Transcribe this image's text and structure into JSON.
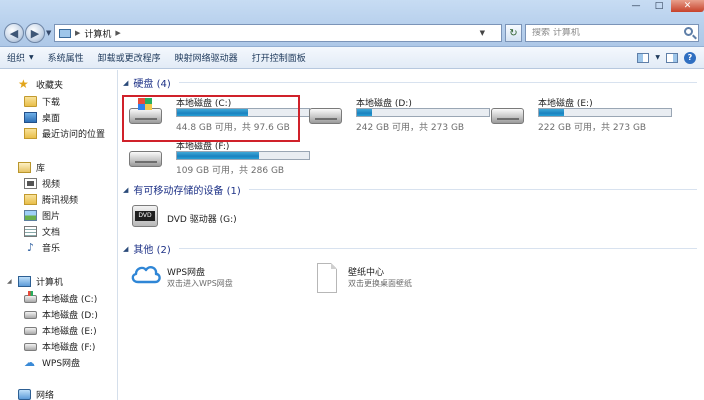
{
  "window": {
    "address_crumb": "计算机",
    "search_placeholder": "搜索 计算机",
    "controls": {
      "minimize": "—",
      "maximize": "□",
      "close": "✕"
    }
  },
  "toolbar": {
    "organize": "组织",
    "system_properties": "系统属性",
    "uninstall": "卸载或更改程序",
    "map_drive": "映射网络驱动器",
    "control_panel": "打开控制面板"
  },
  "nav": {
    "favorites": "收藏夹",
    "downloads": "下载",
    "desktop": "桌面",
    "recent": "最近访问的位置",
    "libraries": "库",
    "videos": "视频",
    "tencent_video": "腾讯视频",
    "pictures": "图片",
    "documents": "文档",
    "music": "音乐",
    "computer": "计算机",
    "drive_c": "本地磁盘 (C:)",
    "drive_d": "本地磁盘 (D:)",
    "drive_e": "本地磁盘 (E:)",
    "drive_f": "本地磁盘 (F:)",
    "wps": "WPS网盘",
    "network": "网络"
  },
  "groups": {
    "hard_disks": "硬盘 (4)",
    "removable": "有可移动存储的设备 (1)",
    "other": "其他 (2)"
  },
  "drives": [
    {
      "name": "本地磁盘 (C:)",
      "space": "44.8 GB 可用，共 97.6 GB",
      "used_fraction": 0.54
    },
    {
      "name": "本地磁盘 (D:)",
      "space": "242 GB 可用，共 273 GB",
      "used_fraction": 0.11
    },
    {
      "name": "本地磁盘 (E:)",
      "space": "222 GB 可用，共 273 GB",
      "used_fraction": 0.19
    },
    {
      "name": "本地磁盘 (F:)",
      "space": "109 GB 可用，共 286 GB",
      "used_fraction": 0.62
    }
  ],
  "dvd": {
    "name": "DVD 驱动器 (G:)",
    "badge": "DVD"
  },
  "others": [
    {
      "name": "WPS网盘",
      "desc": "双击进入WPS网盘"
    },
    {
      "name": "壁纸中心",
      "desc": "双击更换桌面壁纸"
    }
  ]
}
